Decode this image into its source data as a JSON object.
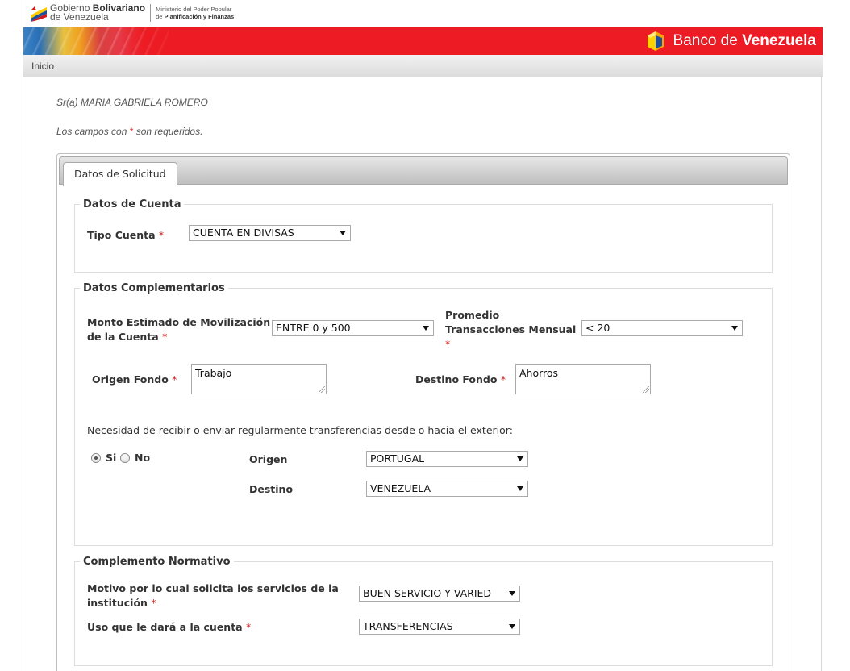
{
  "header": {
    "gov_name_line1_plain": "Gobierno ",
    "gov_name_line1_bold": "Bolivariano",
    "gov_name_line2": "de Venezuela",
    "ministry_line1": "Ministerio del Poder Popular",
    "ministry_line2_prefix": "de ",
    "ministry_line2_bold": "Planificación y Finanzas",
    "bank_name_plain": "Banco de ",
    "bank_name_bold": "Venezuela"
  },
  "nav": {
    "inicio": "Inicio"
  },
  "user": {
    "name": "Sr(a) MARIA GABRIELA ROMERO"
  },
  "note": {
    "prefix": "Los campos con ",
    "asterisk": "*",
    "suffix": " son requeridos."
  },
  "tabs": [
    {
      "label": "Datos de Solicitud"
    }
  ],
  "datos_cuenta": {
    "legend": "Datos de Cuenta",
    "tipo_cuenta_label": "Tipo Cuenta",
    "tipo_cuenta_value": "CUENTA EN DIVISAS"
  },
  "datos_complementarios": {
    "legend": "Datos Complementarios",
    "monto_label_1": "Monto Estimado de Movilización",
    "monto_label_2": "de la Cuenta",
    "monto_value": "ENTRE 0 y 500",
    "promedio_label_1": "Promedio",
    "promedio_label_2": "Transacciones Mensual",
    "promedio_value": "< 20",
    "origen_fondo_label": "Origen Fondo",
    "origen_fondo_value": "Trabajo",
    "destino_fondo_label": "Destino Fondo",
    "destino_fondo_value": "Ahorros",
    "transfer_question": "Necesidad de recibir o enviar regularmente transferencias desde o hacia el exterior:",
    "radio_si": "Si",
    "radio_no": "No",
    "origen_label": "Origen",
    "origen_value": "PORTUGAL",
    "destino_label": "Destino",
    "destino_value": "VENEZUELA"
  },
  "complemento_normativo": {
    "legend": "Complemento Normativo",
    "motivo_label_1": "Motivo por lo cual solicita los servicios de la",
    "motivo_label_2": "institución",
    "motivo_value": "BUEN SERVICIO Y VARIED",
    "uso_label": "Uso que le dará a la cuenta",
    "uso_value": "TRANSFERENCIAS"
  },
  "required_mark": "*",
  "colors": {
    "banner_red": "#ed1c24",
    "required_red": "#d21a1a"
  }
}
